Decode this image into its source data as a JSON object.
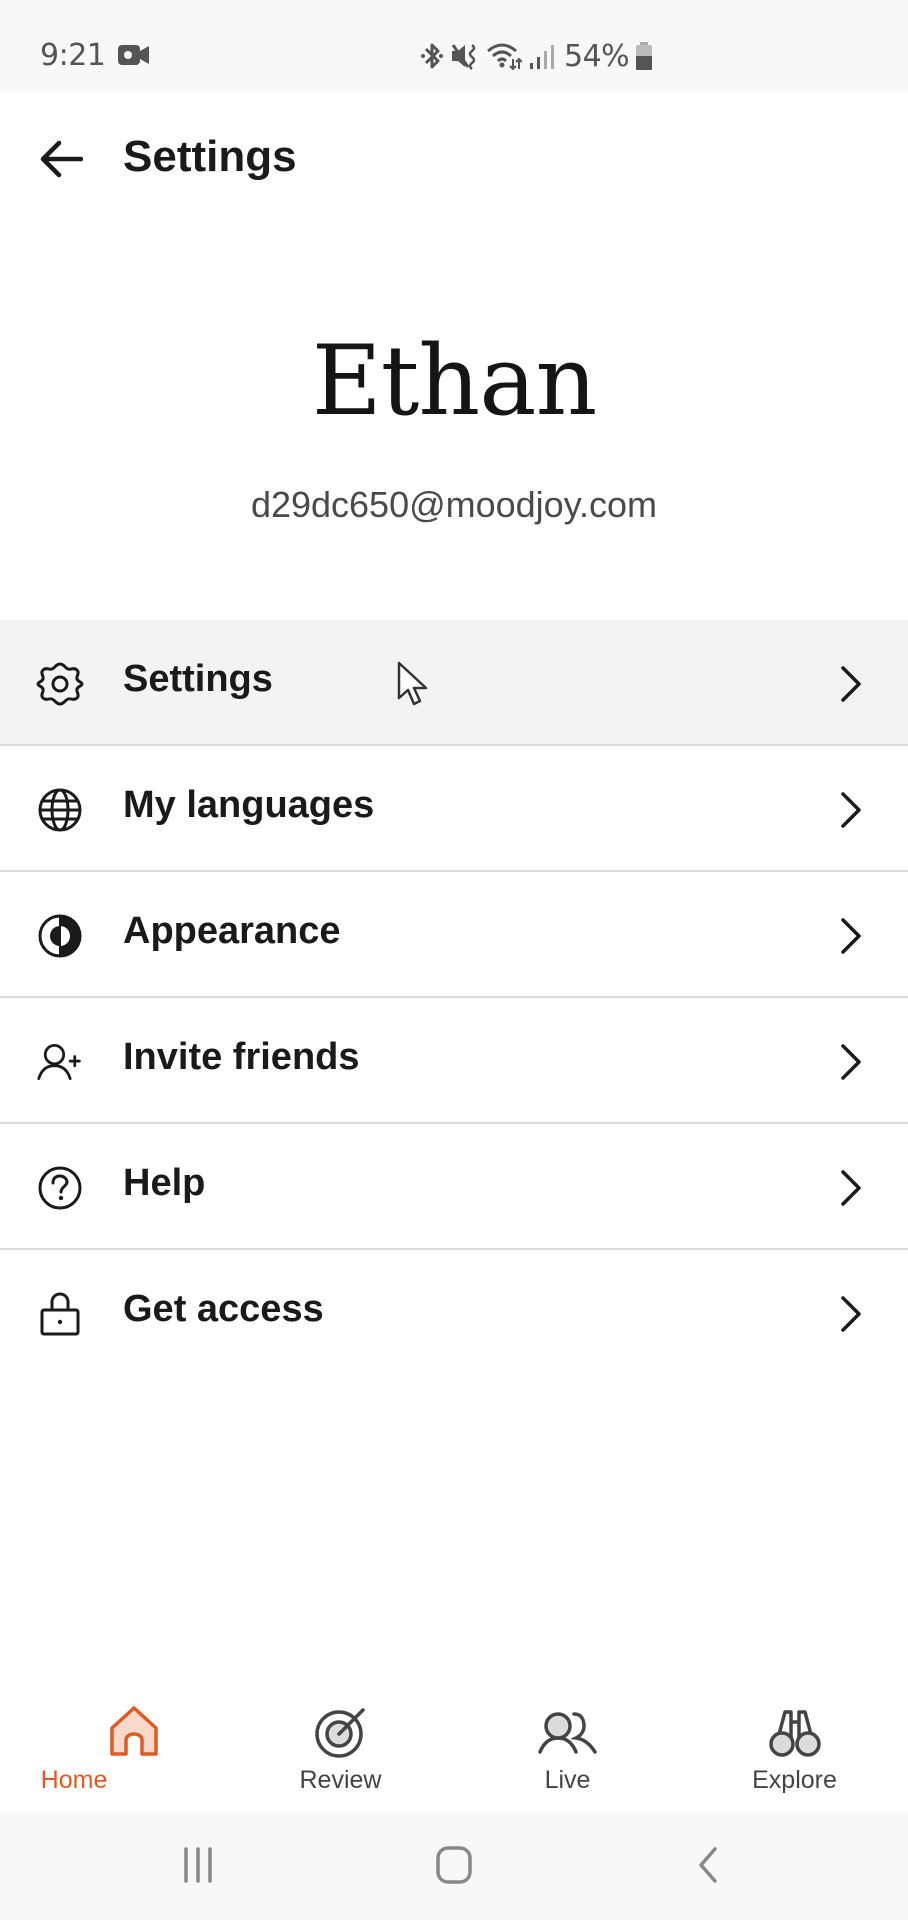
{
  "status_bar": {
    "time": "9:21",
    "battery_percent": "54%",
    "icons": [
      "video-camera-icon",
      "bluetooth-icon",
      "mute-vibrate-icon",
      "wifi-icon",
      "signal-icon",
      "battery-icon"
    ]
  },
  "header": {
    "back_icon": "arrow-left-icon",
    "title": "Settings"
  },
  "profile": {
    "name": "Ethan",
    "email": "d29dc650@moodjoy.com"
  },
  "menu": {
    "items": [
      {
        "label": "Settings",
        "icon": "gear-icon",
        "active": true
      },
      {
        "label": "My languages",
        "icon": "globe-icon",
        "active": false
      },
      {
        "label": "Appearance",
        "icon": "contrast-icon",
        "active": false
      },
      {
        "label": "Invite friends",
        "icon": "user-plus-icon",
        "active": false
      },
      {
        "label": "Help",
        "icon": "help-circle-icon",
        "active": false
      },
      {
        "label": "Get access",
        "icon": "lock-icon",
        "active": false
      }
    ]
  },
  "bottom_nav": {
    "items": [
      {
        "label": "Home",
        "icon": "home-icon",
        "active": true
      },
      {
        "label": "Review",
        "icon": "target-icon",
        "active": false
      },
      {
        "label": "Live",
        "icon": "users-icon",
        "active": false
      },
      {
        "label": "Explore",
        "icon": "binoculars-icon",
        "active": false
      }
    ]
  },
  "system_nav": {
    "buttons": [
      "recent-apps-icon",
      "home-button-icon",
      "back-icon"
    ]
  },
  "colors": {
    "accent": "#e05a22",
    "accent_fill": "#f9d9cc",
    "active_row_bg": "#f3f4f2",
    "divider": "#dcdcdc",
    "text_primary": "#1a1a1a",
    "text_secondary": "#4a4a4a"
  }
}
